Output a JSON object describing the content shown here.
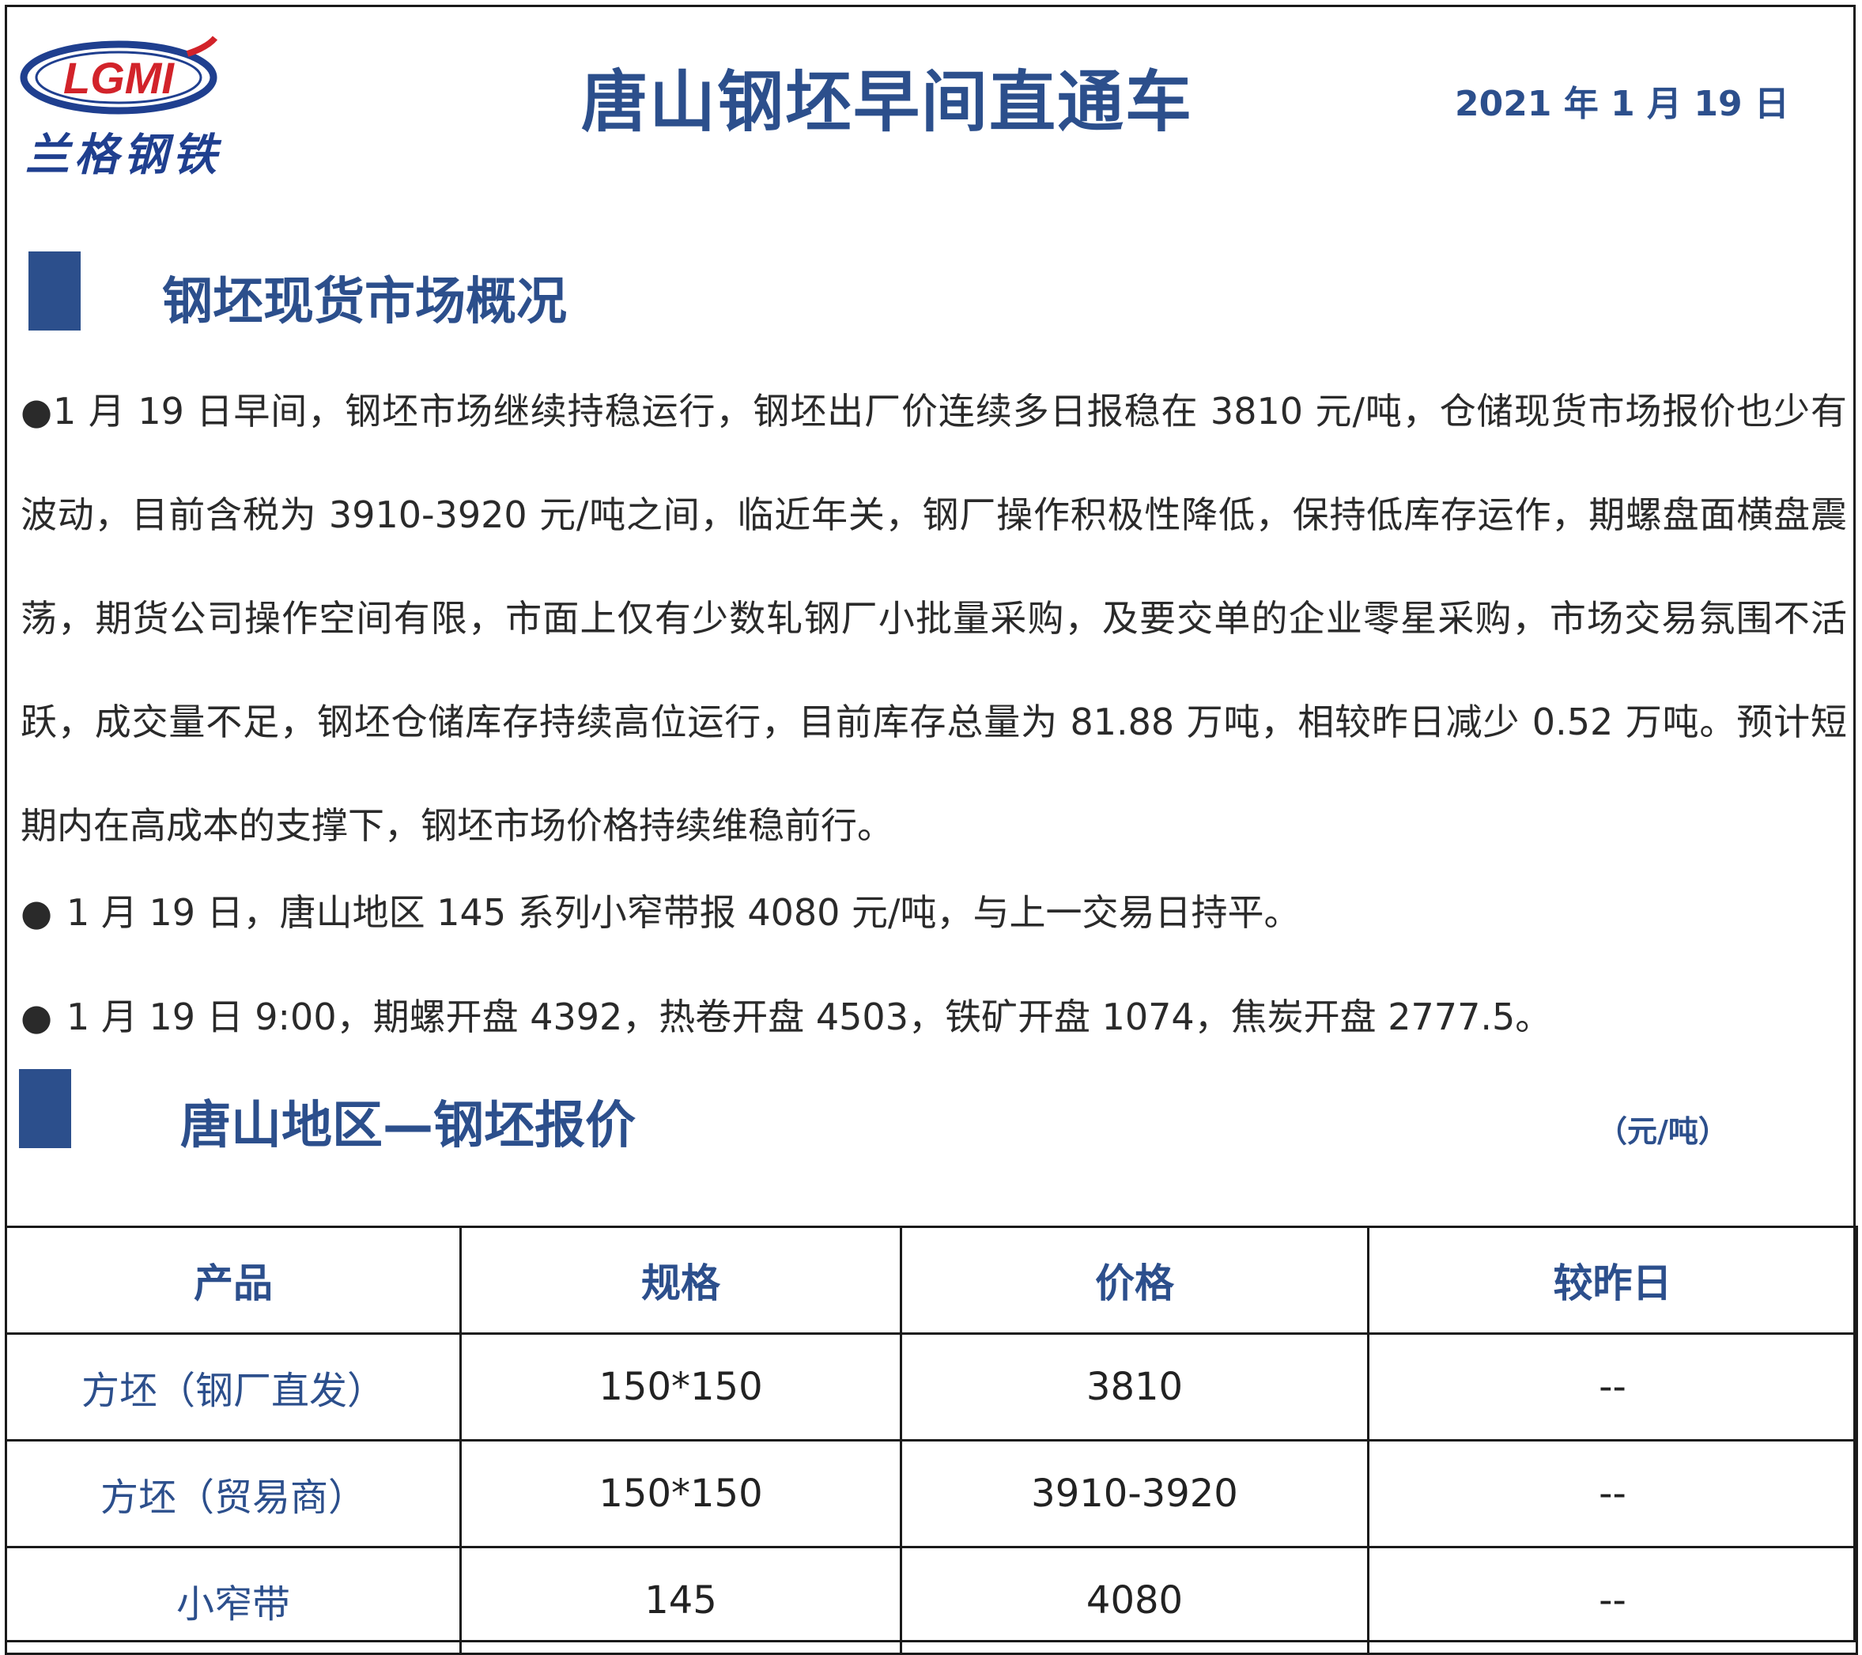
{
  "header": {
    "logo_mark": "LGMI",
    "logo_text": "兰格钢铁",
    "title": "唐山钢坯早间直通车",
    "date": "2021 年 1 月 19 日"
  },
  "colors": {
    "accent": "#2c4f8c",
    "logo_red": "#d2232a",
    "logo_blue": "#1f3f8f"
  },
  "section1": {
    "title": "钢坯现货市场概况",
    "paragraph": "●1 月 19 日早间，钢坯市场继续持稳运行，钢坯出厂价连续多日报稳在 3810 元/吨，仓储现货市场报价也少有波动，目前含税为 3910-3920 元/吨之间，临近年关，钢厂操作积极性降低，保持低库存运作，期螺盘面横盘震荡，期货公司操作空间有限，市面上仅有少数轧钢厂小批量采购，及要交单的企业零星采购，市场交易氛围不活跃，成交量不足，钢坯仓储库存持续高位运行，目前库存总量为 81.88 万吨，相较昨日减少 0.52 万吨。预计短期内在高成本的支撑下，钢坯市场价格持续维稳前行。",
    "bullets": [
      "1 月 19 日，唐山地区 145 系列小窄带报 4080 元/吨，与上一交易日持平。",
      "1 月 19 日 9:00，期螺开盘 4392，热卷开盘 4503，铁矿开盘 1074，焦炭开盘 2777.5。"
    ],
    "bullet_symbol": "●"
  },
  "section2": {
    "title": "唐山地区—钢坯报价",
    "unit": "（元/吨）"
  },
  "table": {
    "headers": [
      "产品",
      "规格",
      "价格",
      "较昨日"
    ],
    "rows": [
      [
        "方坯（钢厂直发）",
        "150*150",
        "3810",
        "--"
      ],
      [
        "方坯（贸易商）",
        "150*150",
        "3910-3920",
        "--"
      ],
      [
        "小窄带",
        "145",
        "4080",
        "--"
      ]
    ]
  }
}
